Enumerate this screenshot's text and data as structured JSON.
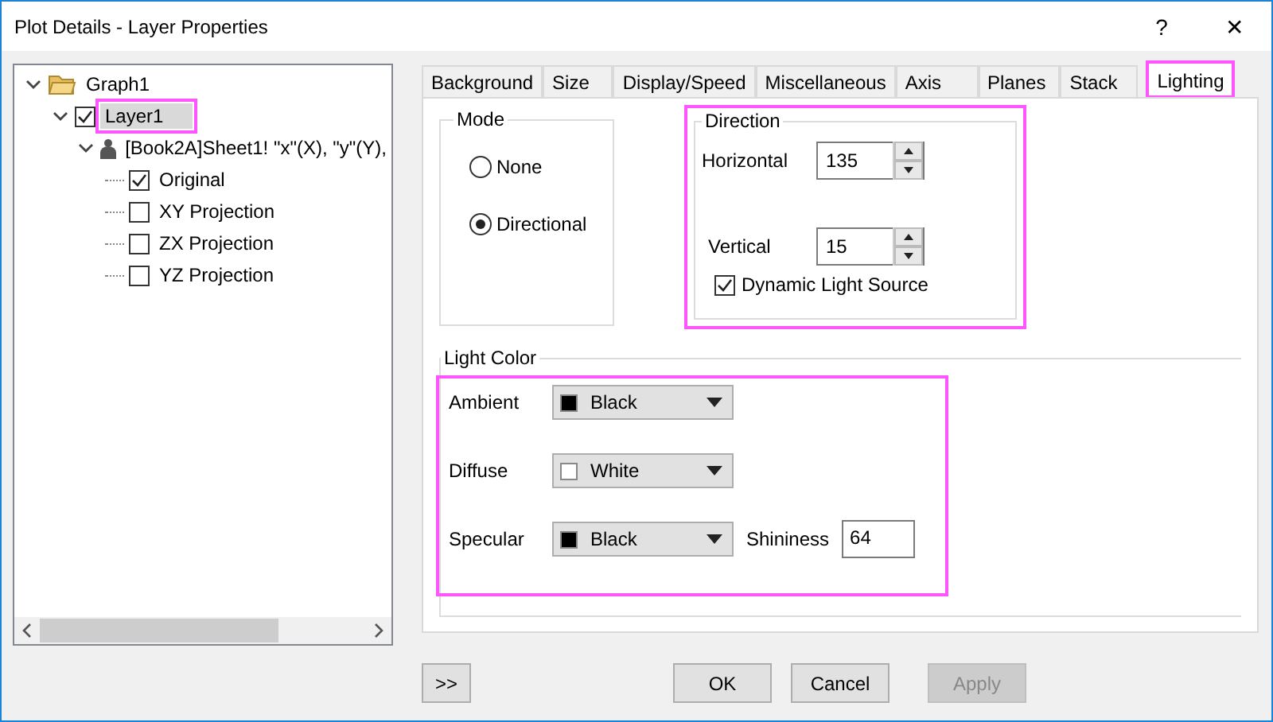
{
  "window": {
    "title": "Plot Details - Layer Properties",
    "help": "?",
    "close": "✕"
  },
  "tree": [
    {
      "kind": "folder",
      "label": "Graph1",
      "expanded": true,
      "children": [
        {
          "kind": "check",
          "label": "Layer1",
          "checked": true,
          "expanded": true,
          "selected": true,
          "highlighted": true,
          "children": [
            {
              "kind": "dataset",
              "label": "[Book2A]Sheet1! \"x\"(X), \"y\"(Y),",
              "expanded": true,
              "children": [
                {
                  "kind": "check",
                  "label": "Original",
                  "checked": true
                },
                {
                  "kind": "check",
                  "label": "XY Projection",
                  "checked": false
                },
                {
                  "kind": "check",
                  "label": "ZX Projection",
                  "checked": false
                },
                {
                  "kind": "check",
                  "label": "YZ Projection",
                  "checked": false
                }
              ]
            }
          ]
        }
      ]
    }
  ],
  "tabs": [
    {
      "label": "Background",
      "selected": false
    },
    {
      "label": "Size",
      "selected": false
    },
    {
      "label": "Display/Speed",
      "selected": false
    },
    {
      "label": "Miscellaneous",
      "selected": false
    },
    {
      "label": "Axis",
      "selected": false
    },
    {
      "label": "Planes",
      "selected": false
    },
    {
      "label": "Stack",
      "selected": false
    },
    {
      "label": "Lighting",
      "selected": true,
      "highlighted": true
    }
  ],
  "mode": {
    "title": "Mode",
    "options": [
      {
        "label": "None",
        "selected": false
      },
      {
        "label": "Directional",
        "selected": true
      }
    ]
  },
  "direction": {
    "title": "Direction",
    "highlighted": true,
    "horizontal": {
      "label": "Horizontal",
      "value": "135"
    },
    "vertical": {
      "label": "Vertical",
      "value": "15"
    },
    "dynamic": {
      "label": "Dynamic Light Source",
      "checked": true
    }
  },
  "light_color": {
    "title": "Light Color",
    "highlighted": true,
    "rows": [
      {
        "label": "Ambient",
        "color": "#000000",
        "value": "Black"
      },
      {
        "label": "Diffuse",
        "color": "#ffffff",
        "value": "White"
      },
      {
        "label": "Specular",
        "color": "#000000",
        "value": "Black",
        "extra_label": "Shininess",
        "extra_value": "64"
      }
    ]
  },
  "buttons": [
    {
      "label": ">>",
      "disabled": false
    },
    {
      "label": "OK",
      "disabled": false
    },
    {
      "label": "Cancel",
      "disabled": false
    },
    {
      "label": "Apply",
      "disabled": true
    }
  ]
}
